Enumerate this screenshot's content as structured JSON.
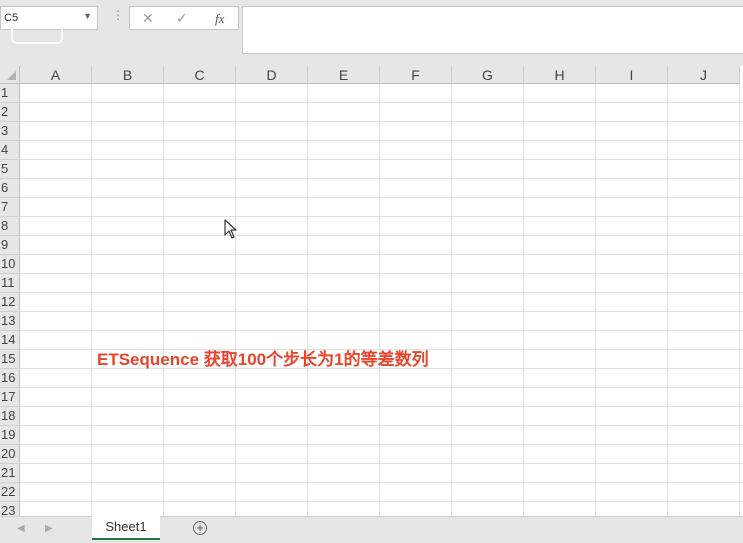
{
  "name_box": {
    "value": "C5",
    "dropdown_glyph": "▼"
  },
  "toolbar": {
    "menu_glyph": "⋮",
    "cancel_glyph": "✕",
    "enter_glyph": "✓",
    "function_glyph": "fx",
    "formula_value": ""
  },
  "columns": [
    "A",
    "B",
    "C",
    "D",
    "E",
    "F",
    "G",
    "H",
    "I",
    "J"
  ],
  "rows": [
    "1",
    "2",
    "3",
    "4",
    "5",
    "6",
    "7",
    "8",
    "9",
    "10",
    "11",
    "12",
    "13",
    "14",
    "15",
    "16",
    "17",
    "18",
    "19",
    "20",
    "21",
    "22",
    "23"
  ],
  "caption": "ETSequence 获取100个步长为1的等差数列",
  "sheet_tabs": {
    "active": "Sheet1",
    "prev_glyph": "◀",
    "next_glyph": "▶",
    "add_glyph": "+"
  },
  "colors": {
    "accent": "#e8452c",
    "active_tab_underline": "#217346",
    "chrome": "#e6e6e6",
    "gridline": "#e1e1e1"
  },
  "icons": [
    "menu-kebab-icon",
    "cancel-icon",
    "enter-check-icon",
    "insert-function-icon",
    "mouse-pointer-icon",
    "add-sheet-icon",
    "scroll-left-icon",
    "scroll-right-icon"
  ]
}
